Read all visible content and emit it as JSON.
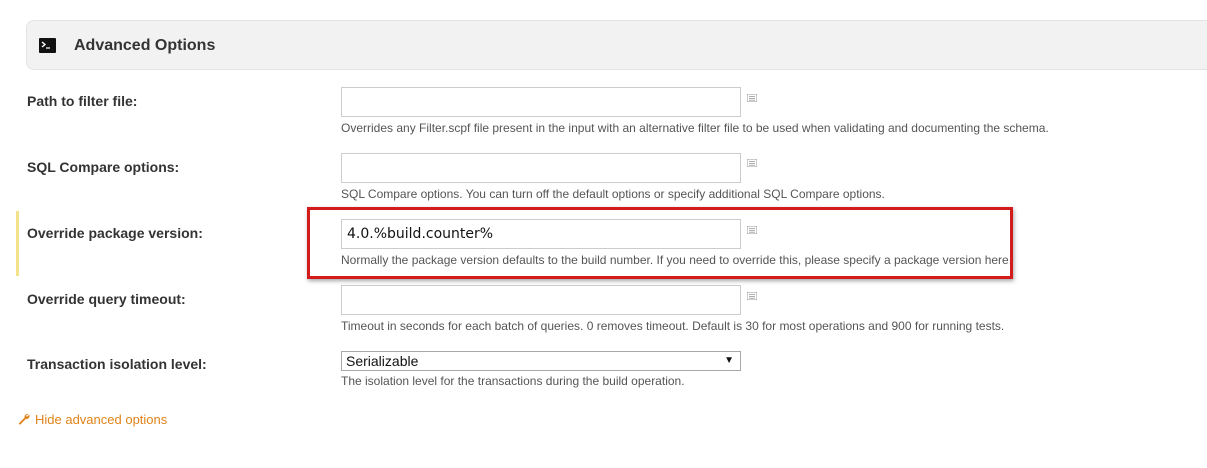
{
  "section": {
    "title": "Advanced Options",
    "icon": "terminal-icon"
  },
  "fields": {
    "filter_file": {
      "label": "Path to filter file:",
      "value": "",
      "help": "Overrides any Filter.scpf file present in the input with an alternative filter file to be used when validating and documenting the schema."
    },
    "sql_compare": {
      "label": "SQL Compare options:",
      "value": "",
      "help": "SQL Compare options. You can turn off the default options or specify additional SQL Compare options."
    },
    "package_version": {
      "label": "Override package version:",
      "value": "4.0.%build.counter%",
      "help": "Normally the package version defaults to the build number. If you need to override this, please specify a package version here."
    },
    "query_timeout": {
      "label": "Override query timeout:",
      "value": "",
      "help": "Timeout in seconds for each batch of queries. 0 removes timeout. Default is 30 for most operations and 900 for running tests."
    },
    "isolation_level": {
      "label": "Transaction isolation level:",
      "selected": "Serializable",
      "help": "The isolation level for the transactions during the build operation."
    }
  },
  "footer": {
    "hide_advanced_label": "Hide advanced options",
    "icon": "wrench-icon"
  },
  "colors": {
    "highlight": "#d41b1b",
    "link": "#e08318",
    "changed_marker": "#f3e28a",
    "header_bg": "#f2f2f2"
  }
}
